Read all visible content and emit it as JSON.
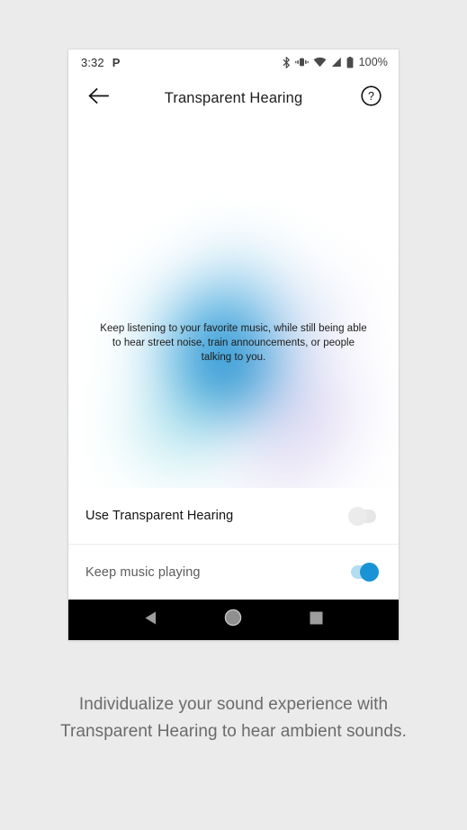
{
  "status_bar": {
    "time": "3:32",
    "notification_icon": "P",
    "icons": [
      "bluetooth-icon",
      "vibrate-icon",
      "wifi-icon",
      "cellular-signal-icon",
      "battery-icon"
    ],
    "battery_percent": "100%"
  },
  "app_bar": {
    "back_icon": "back-arrow-icon",
    "title": "Transparent Hearing",
    "help_icon": "help-circle-icon"
  },
  "hero": {
    "description": "Keep listening to your favorite music, while still being able to hear street noise, train announcements, or people talking to you.",
    "gradient_colors": {
      "core_blue": "#0b7ec4",
      "mid_blue": "#3ba3dd",
      "teal": "#7ad4e2",
      "purple": "#baace4",
      "lavender": "#d6d6f2"
    }
  },
  "settings": {
    "rows": [
      {
        "label": "Use Transparent Hearing",
        "state": "off",
        "toggle_name": "toggle-use-transparent-hearing"
      },
      {
        "label": "Keep music playing",
        "state": "on",
        "toggle_name": "toggle-keep-music-playing"
      }
    ],
    "toggle_on_color": "#1993d6",
    "toggle_on_track_color": "#b3ddf2",
    "toggle_off_color": "#ebebeb"
  },
  "nav_bar": {
    "buttons": [
      {
        "icon": "back-triangle-icon",
        "label": "Back"
      },
      {
        "icon": "home-circle-icon",
        "label": "Home"
      },
      {
        "icon": "recents-square-icon",
        "label": "Recents"
      }
    ],
    "background": "#000000"
  },
  "caption": {
    "text": "Individualize your sound experience with Transparent Hearing to hear ambient sounds."
  },
  "page": {
    "background": "#ebebeb"
  }
}
